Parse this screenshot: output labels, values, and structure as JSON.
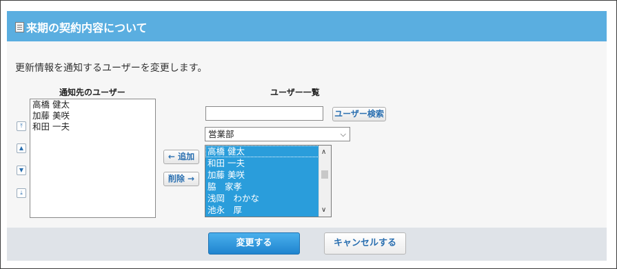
{
  "header": {
    "title": "来期の契約内容について",
    "icon": "document-icon"
  },
  "description": "更新情報を通知するユーザーを変更します。",
  "notify": {
    "heading": "通知先のユーザー",
    "items": [
      "高橋 健太",
      "加藤 美咲",
      "和田 一夫"
    ],
    "controls": {
      "top": "move-top-icon",
      "up": "move-up-icon",
      "down": "move-down-icon",
      "bottom": "move-bottom-icon"
    }
  },
  "actions": {
    "add_label": "← 追加",
    "remove_label": "削除 →"
  },
  "users": {
    "heading": "ユーザー一覧",
    "search_value": "",
    "search_button": "ユーザー検索",
    "department": "営業部",
    "items": [
      "高橋 健太",
      "和田 一夫",
      "加藤 美咲",
      "脇　家孝",
      "浅岡　わかな",
      "池永　厚"
    ]
  },
  "footer": {
    "submit_label": "変更する",
    "cancel_label": "キャンセルする"
  },
  "colors": {
    "header": "#5aaee0",
    "selection": "#2a9ddb",
    "primary": "#1f84cf"
  }
}
